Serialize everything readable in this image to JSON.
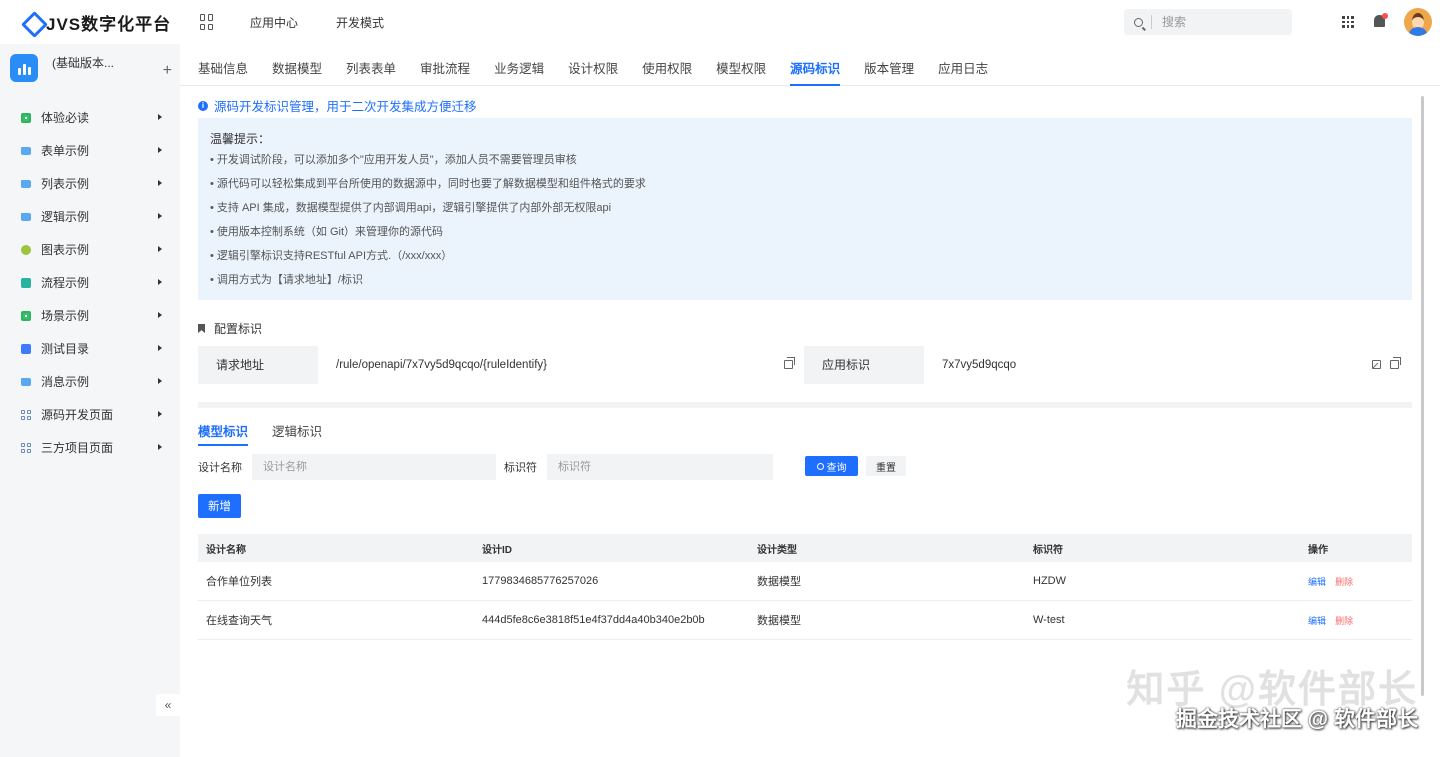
{
  "header": {
    "logo_text": "JVS数字化平台",
    "nav": [
      "应用中心",
      "开发模式"
    ],
    "search_placeholder": "搜索"
  },
  "sidebar": {
    "app_name": "(基础版本...",
    "items": [
      {
        "label": "体验必读",
        "icon": "doc-icon"
      },
      {
        "label": "表单示例",
        "icon": "folder-icon"
      },
      {
        "label": "列表示例",
        "icon": "folder-icon"
      },
      {
        "label": "逻辑示例",
        "icon": "folder-icon"
      },
      {
        "label": "图表示例",
        "icon": "chart-icon"
      },
      {
        "label": "流程示例",
        "icon": "flow-icon"
      },
      {
        "label": "场景示例",
        "icon": "scene-icon"
      },
      {
        "label": "测试目录",
        "icon": "test-icon"
      },
      {
        "label": "消息示例",
        "icon": "folder-icon"
      },
      {
        "label": "源码开发页面",
        "icon": "grid-icon"
      },
      {
        "label": "三方项目页面",
        "icon": "grid-icon"
      }
    ],
    "collapse_label": "«"
  },
  "tabs": [
    "基础信息",
    "数据模型",
    "列表表单",
    "审批流程",
    "业务逻辑",
    "设计权限",
    "使用权限",
    "模型权限",
    "源码标识",
    "版本管理",
    "应用日志"
  ],
  "active_tab": "源码标识",
  "info_text": "源码开发标识管理，用于二次开发集成方便迁移",
  "tips": {
    "title": "温馨提示：",
    "lines": [
      "• 开发调试阶段，可以添加多个\"应用开发人员\"，添加人员不需要管理员审核",
      "• 源代码可以轻松集成到平台所使用的数据源中，同时也要了解数据模型和组件格式的要求",
      "• 支持 API 集成，数据模型提供了内部调用api，逻辑引擎提供了内部外部无权限api",
      "• 使用版本控制系统（如 Git）来管理你的源代码",
      "• 逻辑引擎标识支持RESTful API方式.（/xxx/xxx）",
      "• 调用方式为【请求地址】/标识"
    ]
  },
  "config": {
    "title": "配置标识",
    "request_label": "请求地址",
    "request_value": "/rule/openapi/7x7vy5d9qcqo/{ruleIdentify}",
    "app_label": "应用标识",
    "app_value": "7x7vy5d9qcqo"
  },
  "subtabs": [
    "模型标识",
    "逻辑标识"
  ],
  "filter": {
    "name_label": "设计名称",
    "name_placeholder": "设计名称",
    "id_label": "标识符",
    "id_placeholder": "标识符",
    "query": "查询",
    "reset": "重置",
    "add": "新增"
  },
  "table": {
    "columns": [
      "设计名称",
      "设计ID",
      "设计类型",
      "标识符",
      "操作"
    ],
    "rows": [
      {
        "name": "合作单位列表",
        "id": "1779834685776257026",
        "type": "数据模型",
        "code": "HZDW"
      },
      {
        "name": "在线查询天气",
        "id": "444d5fe8c6e3818f51e4f37dd4a40b340e2b0b",
        "type": "数据模型",
        "code": "W-test"
      }
    ],
    "op_edit": "编辑",
    "op_delete": "删除"
  },
  "watermark": {
    "line1": "知乎 @软件部长",
    "line2": "掘金技术社区 @ 软件部长"
  }
}
